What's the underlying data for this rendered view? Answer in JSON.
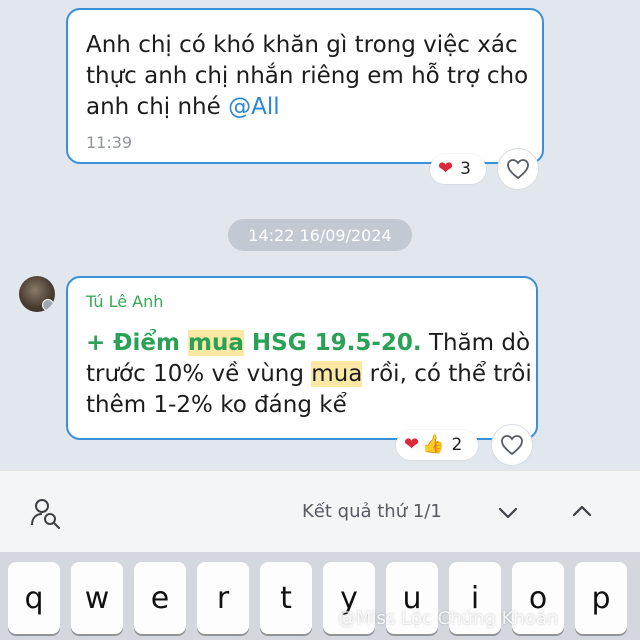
{
  "messages": [
    {
      "text_plain": "Anh chị có khó khăn gì trong việc xác thực anh chị nhắn riêng em hỗ trợ cho anh chị nhé ",
      "mention": "@All",
      "time": "11:39",
      "reactions": {
        "icons": [
          "heart-icon"
        ],
        "count": "3"
      }
    },
    {
      "sender": "Tú Lê Anh",
      "parts": {
        "p1": "+ Điểm ",
        "p2": "mua",
        "p3": " HSG 19.5-20.",
        "p4": " Thăm dò trước 10% về vùng ",
        "p5": "mua",
        "p6": " rồi, có thể trôi thêm 1-2% ko đáng kể"
      },
      "reactions": {
        "icons": [
          "heart-icon",
          "thumbs-up-icon"
        ],
        "count": "2"
      }
    }
  ],
  "date_separator": "14:22 16/09/2024",
  "search": {
    "result_text": "Kết quả thứ 1/1"
  },
  "keyboard": {
    "keys": [
      "q",
      "w",
      "e",
      "r",
      "t",
      "y",
      "u",
      "i",
      "o",
      "p"
    ]
  },
  "watermark": "@Miss Lộc Chứng Khoán",
  "colors": {
    "bubble_border": "#3a8fd9",
    "sender": "#38a85a",
    "highlight": "#fae8a4",
    "mention": "#2a86d9"
  }
}
